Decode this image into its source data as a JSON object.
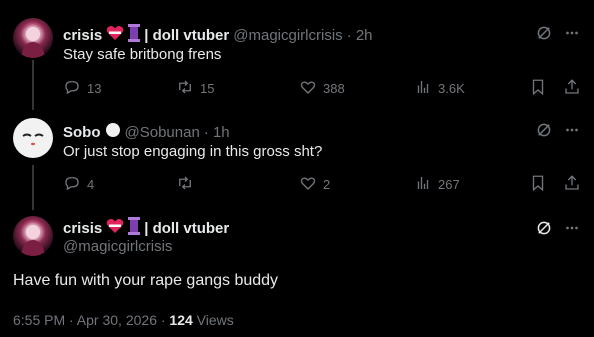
{
  "tweets": [
    {
      "display_name": "crisis",
      "display_suffix": "| doll vtuber",
      "handle": "@magicgirlcrisis",
      "time": "· 2h",
      "text": "Stay safe britbong frens",
      "replies": "13",
      "retweets": "15",
      "likes": "388",
      "views": "3.6K"
    },
    {
      "display_name": "Sobo",
      "handle": "@Sobunan",
      "time": "· 1h",
      "text": "Or just stop engaging in this gross sht?",
      "replies": "4",
      "retweets": "",
      "likes": "2",
      "views": "267"
    }
  ],
  "main": {
    "display_name": "crisis",
    "display_suffix": "| doll vtuber",
    "handle": "@magicgirlcrisis",
    "text": "Have fun with your rape gangs buddy",
    "timestamp": "6:55 PM · Apr 30, 2026 ·",
    "views_count": "124",
    "views_label": "Views"
  },
  "icons": [
    "reply-icon",
    "retweet-icon",
    "like-icon",
    "views-icon",
    "bookmark-icon",
    "share-icon",
    "grok-icon",
    "more-icon"
  ],
  "colors": {
    "background": "#000000",
    "text": "#e7e9ea",
    "muted": "#71767b"
  }
}
